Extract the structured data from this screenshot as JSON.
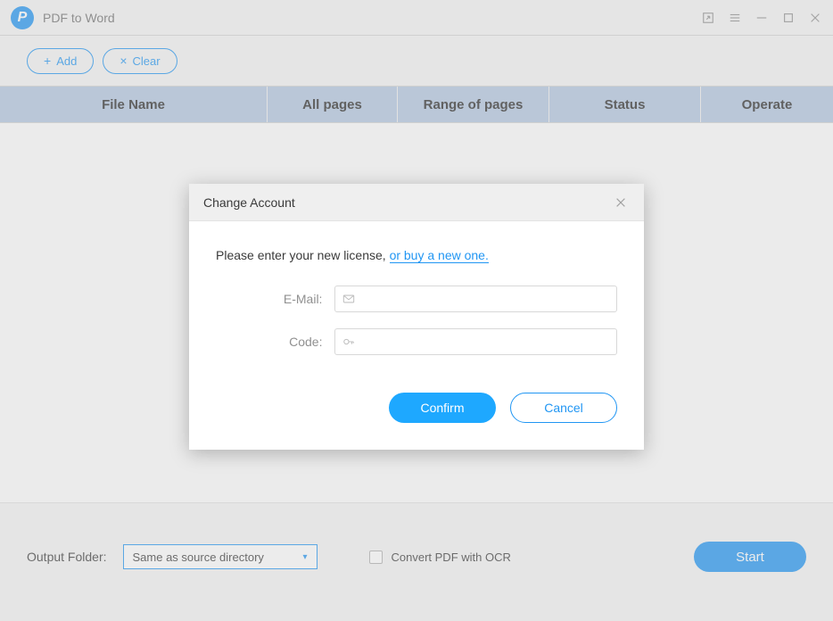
{
  "app": {
    "title": "PDF to Word",
    "logo_letter": "P"
  },
  "toolbar": {
    "add_label": "Add",
    "clear_label": "Clear"
  },
  "table": {
    "headers": {
      "filename": "File Name",
      "allpages": "All pages",
      "range": "Range of pages",
      "status": "Status",
      "operate": "Operate"
    }
  },
  "bottom": {
    "output_folder_label": "Output Folder:",
    "folder_selected": "Same as source directory",
    "ocr_label": "Convert PDF with OCR",
    "start_label": "Start"
  },
  "modal": {
    "title": "Change Account",
    "license_prefix": "Please enter your new license, ",
    "license_link": "or buy a new one.",
    "email_label": "E-Mail:",
    "code_label": "Code:",
    "confirm_label": "Confirm",
    "cancel_label": "Cancel"
  }
}
